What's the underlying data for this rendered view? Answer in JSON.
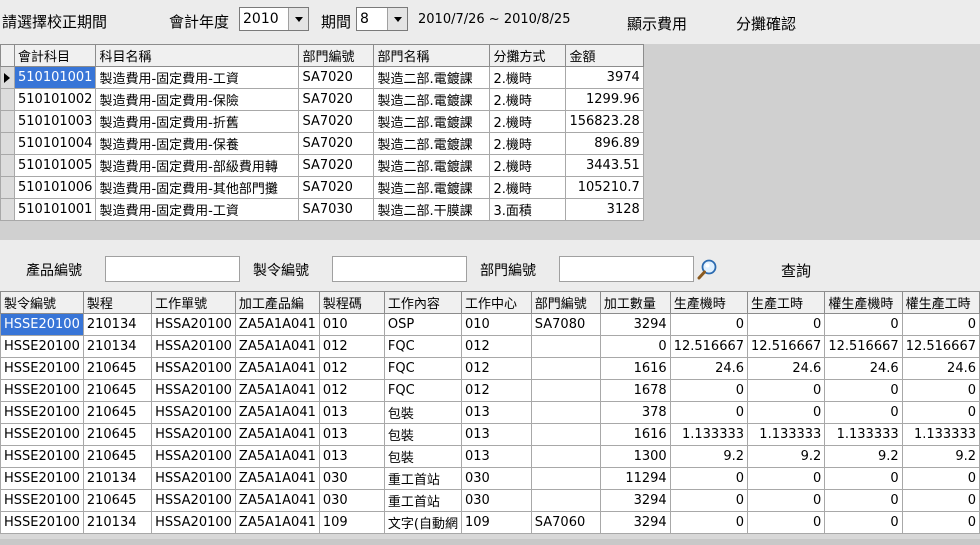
{
  "toolbar": {
    "title": "請選擇校正期間",
    "year_label": "會計年度",
    "year_value": "2010",
    "period_label": "期間",
    "period_value": "8",
    "date_range": "2010/7/26 ~ 2010/8/25",
    "show_cost_label": "顯示費用",
    "allocate_confirm_label": "分攤確認"
  },
  "top_grid": {
    "columns": [
      "會計科目",
      "科目名稱",
      "部門編號",
      "部門名稱",
      "分攤方式",
      "金額"
    ],
    "rows": [
      [
        "510101001",
        "製造費用-固定費用-工資",
        "SA7020",
        "製造二部.電鍍課",
        "2.機時",
        "3974"
      ],
      [
        "510101002",
        "製造費用-固定費用-保險",
        "SA7020",
        "製造二部.電鍍課",
        "2.機時",
        "1299.96"
      ],
      [
        "510101003",
        "製造費用-固定費用-折舊",
        "SA7020",
        "製造二部.電鍍課",
        "2.機時",
        "156823.28"
      ],
      [
        "510101004",
        "製造費用-固定費用-保養",
        "SA7020",
        "製造二部.電鍍課",
        "2.機時",
        "896.89"
      ],
      [
        "510101005",
        "製造費用-固定費用-部級費用轉",
        "SA7020",
        "製造二部.電鍍課",
        "2.機時",
        "3443.51"
      ],
      [
        "510101006",
        "製造費用-固定費用-其他部門攤",
        "SA7020",
        "製造二部.電鍍課",
        "2.機時",
        "105210.7"
      ],
      [
        "510101001",
        "製造費用-固定費用-工資",
        "SA7030",
        "製造二部.干膜課",
        "3.面積",
        "3128"
      ]
    ]
  },
  "search": {
    "product_label": "產品編號",
    "product_value": "",
    "order_label": "製令編號",
    "order_value": "",
    "dept_label": "部門編號",
    "dept_value": "",
    "query_label": "查詢"
  },
  "bottom_grid": {
    "columns": [
      "製令編號",
      "製程",
      "工作單號",
      "加工產品編",
      "製程碼",
      "工作內容",
      "工作中心",
      "部門編號",
      "加工數量",
      "生產機時",
      "生產工時",
      "權生產機時",
      "權生產工時"
    ],
    "rows": [
      [
        "HSSE20100",
        "210134",
        "HSSA20100",
        "ZA5A1A041",
        "010",
        "OSP",
        "010",
        "SA7080",
        "3294",
        "0",
        "0",
        "0",
        "0"
      ],
      [
        "HSSE20100",
        "210134",
        "HSSA20100",
        "ZA5A1A041",
        "012",
        "FQC",
        "012",
        "",
        "0",
        "12.516667",
        "12.516667",
        "12.516667",
        "12.516667"
      ],
      [
        "HSSE20100",
        "210645",
        "HSSA20100",
        "ZA5A1A041",
        "012",
        "FQC",
        "012",
        "",
        "1616",
        "24.6",
        "24.6",
        "24.6",
        "24.6"
      ],
      [
        "HSSE20100",
        "210645",
        "HSSA20100",
        "ZA5A1A041",
        "012",
        "FQC",
        "012",
        "",
        "1678",
        "0",
        "0",
        "0",
        "0"
      ],
      [
        "HSSE20100",
        "210645",
        "HSSA20100",
        "ZA5A1A041",
        "013",
        "包裝",
        "013",
        "",
        "378",
        "0",
        "0",
        "0",
        "0"
      ],
      [
        "HSSE20100",
        "210645",
        "HSSA20100",
        "ZA5A1A041",
        "013",
        "包裝",
        "013",
        "",
        "1616",
        "1.133333",
        "1.133333",
        "1.133333",
        "1.133333"
      ],
      [
        "HSSE20100",
        "210645",
        "HSSA20100",
        "ZA5A1A041",
        "013",
        "包裝",
        "013",
        "",
        "1300",
        "9.2",
        "9.2",
        "9.2",
        "9.2"
      ],
      [
        "HSSE20100",
        "210134",
        "HSSA20100",
        "ZA5A1A041",
        "030",
        "重工首站",
        "030",
        "",
        "11294",
        "0",
        "0",
        "0",
        "0"
      ],
      [
        "HSSE20100",
        "210645",
        "HSSA20100",
        "ZA5A1A041",
        "030",
        "重工首站",
        "030",
        "",
        "3294",
        "0",
        "0",
        "0",
        "0"
      ],
      [
        "HSSE20100",
        "210134",
        "HSSA20100",
        "ZA5A1A041",
        "109",
        "文字(自動網",
        "109",
        "SA7060",
        "3294",
        "0",
        "0",
        "0",
        "0"
      ]
    ]
  },
  "colors": {
    "selection": "#3875d7",
    "background": "#ececec"
  }
}
